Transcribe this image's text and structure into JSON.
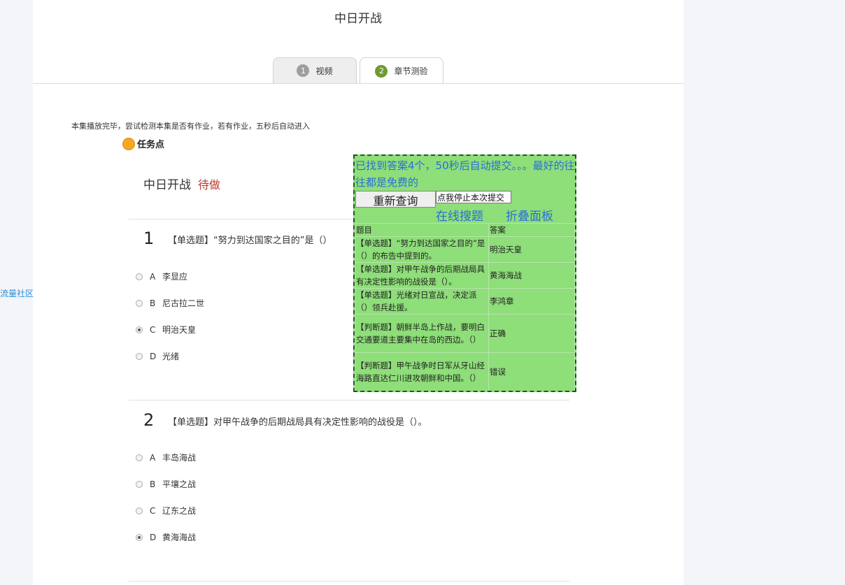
{
  "page": {
    "title": "中日开战"
  },
  "tabs": [
    {
      "num": "1",
      "label": "视频"
    },
    {
      "num": "2",
      "label": "章节测验"
    }
  ],
  "notice": "本集播放完毕，尝试检测本集是否有作业，若有作业，五秒后自动进入",
  "task_point": "任务点",
  "chapter": {
    "title": "中日开战",
    "status": "待做"
  },
  "side_link": "流量社区",
  "questions": [
    {
      "num": "1",
      "text": "【单选题】“努力到达国家之目的”是（）",
      "options": [
        {
          "letter": "A",
          "text": "李显应",
          "checked": false
        },
        {
          "letter": "B",
          "text": "尼古拉二世",
          "checked": false
        },
        {
          "letter": "C",
          "text": "明治天皇",
          "checked": true
        },
        {
          "letter": "D",
          "text": "光绪",
          "checked": false
        }
      ]
    },
    {
      "num": "2",
      "text": "【单选题】对甲午战争的后期战局具有决定性影响的战役是（）。",
      "options": [
        {
          "letter": "A",
          "text": "丰岛海战",
          "checked": false
        },
        {
          "letter": "B",
          "text": "平壤之战",
          "checked": false
        },
        {
          "letter": "C",
          "text": "辽东之战",
          "checked": false
        },
        {
          "letter": "D",
          "text": "黄海海战",
          "checked": true
        }
      ]
    }
  ],
  "panel": {
    "message": "已找到答案4个，50秒后自动提交。。。最好的往往都是免费的",
    "requery_label": "重新查询",
    "stop_label": "点我停止本次提交",
    "search_link": "在线搜题",
    "fold_link": "折叠面板",
    "table_headers": [
      "题目",
      "答案"
    ],
    "rows": [
      {
        "question": "【单选题】“努力到达国家之目的”是（）的布告中提到的。",
        "answer": "明治天皇"
      },
      {
        "question": "【单选题】对甲午战争的后期战局具有决定性影响的战役是（）。",
        "answer": "黄海海战"
      },
      {
        "question": "【单选题】光绪对日宣战，决定派（）领兵赴援。",
        "answer": "李鸿章"
      },
      {
        "question": "【判断题】朝鲜半岛上作战，要明白交通要道主要集中在岛的西边。（）",
        "answer": "正确"
      },
      {
        "question": "【判断题】甲午战争时日军从牙山经海路直达仁川进攻朝鲜和中国。（）",
        "answer": "错误"
      }
    ]
  },
  "colors": {
    "panel_bg": "#8ede79",
    "link_blue": "#2a6fd6",
    "status_red": "#c0392b",
    "task_dot": "#f5a623"
  }
}
